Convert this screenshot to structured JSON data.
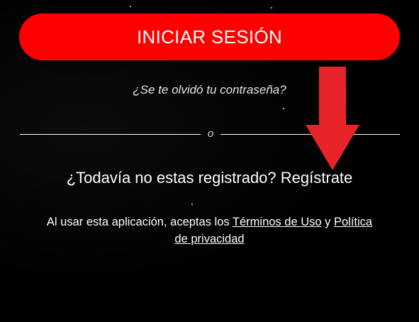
{
  "login": {
    "button_label": "INICIAR SESIÓN"
  },
  "forgot_password": {
    "label": "¿Se te olvidó tu contraseña?"
  },
  "divider": {
    "label": "o"
  },
  "register": {
    "question": "¿Todavía no estas registrado?",
    "link_label": "Regístrate"
  },
  "legal": {
    "prefix": "Al usar esta aplicación, aceptas los",
    "terms_label": "Términos de Uso",
    "joiner": "y",
    "privacy_label_1": "Política",
    "privacy_label_2": "de privacidad"
  },
  "colors": {
    "primary_button": "#ff0000",
    "background": "#000000",
    "annotation_arrow": "#e8242b",
    "text": "#ffffff"
  },
  "icons": {
    "annotation": "down-arrow-icon"
  }
}
